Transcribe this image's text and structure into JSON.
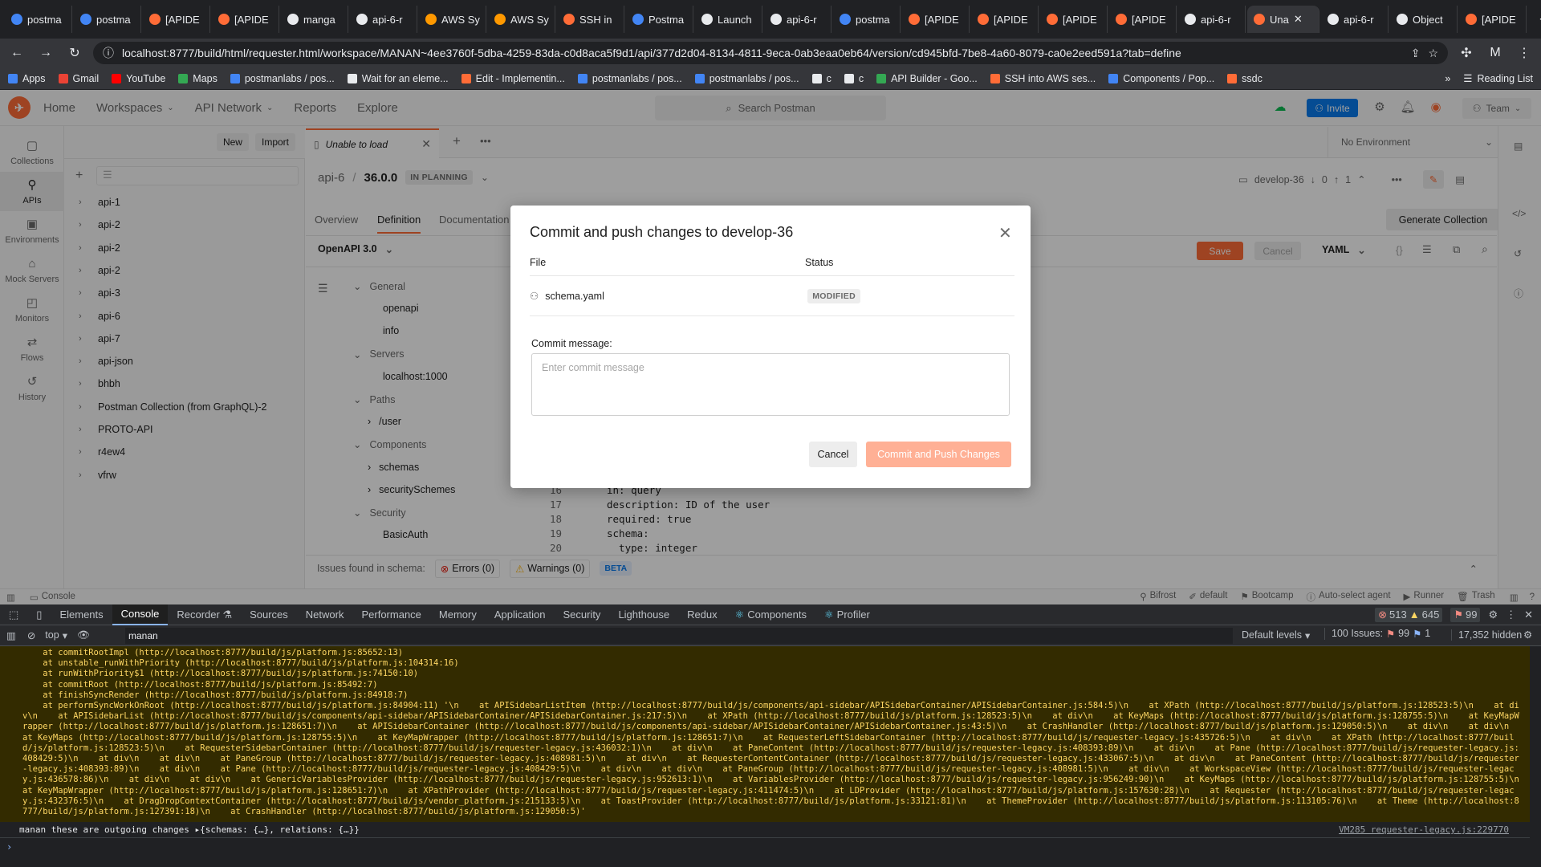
{
  "browser": {
    "tabs": [
      {
        "label": "postma",
        "color": "#4285f4"
      },
      {
        "label": "postma",
        "color": "#4285f4"
      },
      {
        "label": "[APIDE",
        "color": "#ff6c37"
      },
      {
        "label": "[APIDE",
        "color": "#ff6c37"
      },
      {
        "label": "manga",
        "color": "#e8eaed"
      },
      {
        "label": "api-6-r",
        "color": "#e8eaed"
      },
      {
        "label": "AWS Sy",
        "color": "#ff9900"
      },
      {
        "label": "AWS Sy",
        "color": "#ff9900"
      },
      {
        "label": "SSH in",
        "color": "#ff6c37"
      },
      {
        "label": "Postma",
        "color": "#4285f4"
      },
      {
        "label": "Launch",
        "color": "#e8eaed"
      },
      {
        "label": "api-6-r",
        "color": "#e8eaed"
      },
      {
        "label": "postma",
        "color": "#4285f4"
      },
      {
        "label": "[APIDE",
        "color": "#ff6c37"
      },
      {
        "label": "[APIDE",
        "color": "#ff6c37"
      },
      {
        "label": "[APIDE",
        "color": "#ff6c37"
      },
      {
        "label": "[APIDE",
        "color": "#ff6c37"
      },
      {
        "label": "api-6-r",
        "color": "#e8eaed"
      },
      {
        "label": "Una",
        "color": "#ff6c37",
        "active": true
      },
      {
        "label": "api-6-r",
        "color": "#e8eaed"
      },
      {
        "label": "Object",
        "color": "#e8eaed"
      },
      {
        "label": "[APIDE",
        "color": "#ff6c37"
      }
    ],
    "url": "localhost:8777/build/html/requester.html/workspace/MANAN~4ee3760f-5dba-4259-83da-c0d8aca5f9d1/api/377d2d04-8134-4811-9eca-0ab3eaa0eb64/version/cd945bfd-7be8-4a60-8079-ca0e2eed591a?tab=define",
    "profile_initial": "M",
    "bookmarks": [
      {
        "label": "Apps",
        "color": "#4285f4"
      },
      {
        "label": "Gmail",
        "color": "#ea4335"
      },
      {
        "label": "YouTube",
        "color": "#ff0000"
      },
      {
        "label": "Maps",
        "color": "#34a853"
      },
      {
        "label": "postmanlabs / pos...",
        "color": "#4285f4"
      },
      {
        "label": "Wait for an eleme...",
        "color": "#e8eaed"
      },
      {
        "label": "Edit - Implementin...",
        "color": "#ff6c37"
      },
      {
        "label": "postmanlabs / pos...",
        "color": "#4285f4"
      },
      {
        "label": "postmanlabs / pos...",
        "color": "#4285f4"
      },
      {
        "label": "c",
        "color": "#e8eaed"
      },
      {
        "label": "c",
        "color": "#e8eaed"
      },
      {
        "label": "API Builder - Goo...",
        "color": "#34a853"
      },
      {
        "label": "SSH into AWS ses...",
        "color": "#ff6c37"
      },
      {
        "label": "Components / Pop...",
        "color": "#4285f4"
      },
      {
        "label": "ssdc",
        "color": "#ff6c37"
      }
    ],
    "reading_list": "Reading List"
  },
  "header": {
    "nav": [
      "Home",
      "Workspaces",
      "API Network",
      "Reports",
      "Explore"
    ],
    "search_placeholder": "Search Postman",
    "invite": "Invite",
    "team": "Team"
  },
  "rail": [
    {
      "label": "Collections",
      "icon": "collections-icon",
      "glyph": "▢"
    },
    {
      "label": "APIs",
      "icon": "apis-icon",
      "glyph": "⚲",
      "active": true
    },
    {
      "label": "Environments",
      "icon": "environments-icon",
      "glyph": "▣"
    },
    {
      "label": "Mock Servers",
      "icon": "mock-servers-icon",
      "glyph": "⌂"
    },
    {
      "label": "Monitors",
      "icon": "monitors-icon",
      "glyph": "◰"
    },
    {
      "label": "Flows",
      "icon": "flows-icon",
      "glyph": "⇄"
    },
    {
      "label": "History",
      "icon": "history-icon",
      "glyph": "↺"
    }
  ],
  "sidebar": {
    "workspace": "MANAN",
    "new": "New",
    "import": "Import",
    "items": [
      "api-1",
      "api-2",
      "api-2",
      "api-2",
      "api-3",
      "api-6",
      "api-7",
      "api-json",
      "bhbh",
      "Postman Collection (from GraphQL)-2",
      "PROTO-API",
      "r4ew4",
      "vfrw"
    ]
  },
  "main": {
    "tab_label": "Unable to load",
    "environment": "No Environment",
    "api_name": "api-6",
    "version": "36.0.0",
    "stage": "IN PLANNING",
    "branch": "develop-36",
    "behind": "0",
    "ahead": "1",
    "subtabs": [
      "Overview",
      "Definition",
      "Documentation"
    ],
    "generate_collection": "Generate Collection",
    "openapi": "OpenAPI 3.0",
    "save": "Save",
    "cancel": "Cancel",
    "format": "YAML",
    "outline": [
      {
        "label": "General",
        "section": true
      },
      {
        "label": "openapi"
      },
      {
        "label": "info"
      },
      {
        "label": "Servers",
        "section": true
      },
      {
        "label": "localhost:1000"
      },
      {
        "label": "Paths",
        "section": true
      },
      {
        "label": "/user",
        "chev": true
      },
      {
        "label": "Components",
        "section": true
      },
      {
        "label": "schemas",
        "chev": true
      },
      {
        "label": "securitySchemes",
        "chev": true
      },
      {
        "label": "Security",
        "section": true
      },
      {
        "label": "BasicAuth"
      }
    ],
    "code": [
      {
        "n": "16",
        "t": "in: query"
      },
      {
        "n": "17",
        "t": "description: ID of the user"
      },
      {
        "n": "18",
        "t": "required: true"
      },
      {
        "n": "19",
        "t": "schema:"
      },
      {
        "n": "20",
        "t": "  type: integer"
      }
    ],
    "issues_label": "Issues found in schema:",
    "errors": "Errors (0)",
    "warnings": "Warnings (0)",
    "beta": "BETA"
  },
  "statusbar": {
    "console": "Console",
    "items": [
      "Bifrost",
      "default",
      "Bootcamp",
      "Auto-select agent",
      "Runner",
      "Trash"
    ]
  },
  "modal": {
    "title": "Commit and push changes to develop-36",
    "col_file": "File",
    "col_status": "Status",
    "file": "schema.yaml",
    "status": "MODIFIED",
    "commit_label": "Commit message:",
    "commit_placeholder": "Enter commit message",
    "cancel": "Cancel",
    "commit": "Commit and Push Changes"
  },
  "devtools": {
    "tabs": [
      "Elements",
      "Console",
      "Recorder ⚗",
      "Sources",
      "Network",
      "Performance",
      "Memory",
      "Application",
      "Security",
      "Lighthouse",
      "Redux",
      "Components",
      "Profiler"
    ],
    "errors": "513",
    "warnings": "645",
    "issues_count": "99",
    "context": "top",
    "filter": "manan",
    "levels": "Default levels",
    "issues_label": "100 Issues:",
    "issues_err": "99",
    "issues_info": "1",
    "hidden": "17,352 hidden",
    "log_stack": [
      "    at commitRootImpl (http://localhost:8777/build/js/platform.js:85652:13)",
      "    at unstable_runWithPriority (http://localhost:8777/build/js/platform.js:104314:16)",
      "    at runWithPriority$1 (http://localhost:8777/build/js/platform.js:74150:10)",
      "    at commitRoot (http://localhost:8777/build/js/platform.js:85492:7)",
      "    at finishSyncRender (http://localhost:8777/build/js/platform.js:84918:7)",
      "    at performSyncWorkOnRoot (http://localhost:8777/build/js/platform.js:84904:11) '\\n    at APISidebarListItem (http://localhost:8777/build/js/components/api-sidebar/APISidebarContainer/APISidebarContainer.js:584:5)\\n    at XPath (http://localhost:8777/build/js/platform.js:128523:5)\\n    at div\\n    at APISidebarList (http://localhost:8777/build/js/components/api-sidebar/APISidebarContainer/APISidebarContainer.js:217:5)\\n    at XPath (http://localhost:8777/build/js/platform.js:128523:5)\\n    at div\\n    at KeyMaps (http://localhost:8777/build/js/platform.js:128755:5)\\n    at KeyMapWrapper (http://localhost:8777/build/js/platform.js:128651:7)\\n    at APISidebarContainer (http://localhost:8777/build/js/components/api-sidebar/APISidebarContainer/APISidebarContainer.js:43:5)\\n    at CrashHandler (http://localhost:8777/build/js/platform.js:129050:5)\\n    at div\\n    at div\\n    at KeyMaps (http://localhost:8777/build/js/platform.js:128755:5)\\n    at KeyMapWrapper (http://localhost:8777/build/js/platform.js:128651:7)\\n    at RequesterLeftSidebarContainer (http://localhost:8777/build/js/requester-legacy.js:435726:5)\\n    at div\\n    at XPath (http://localhost:8777/build/js/platform.js:128523:5)\\n    at RequesterSidebarContainer (http://localhost:8777/build/js/requester-legacy.js:436032:1)\\n    at div\\n    at PaneContent (http://localhost:8777/build/js/requester-legacy.js:408393:89)\\n    at div\\n    at Pane (http://localhost:8777/build/js/requester-legacy.js:408429:5)\\n    at div\\n    at div\\n    at PaneGroup (http://localhost:8777/build/js/requester-legacy.js:408981:5)\\n    at div\\n    at RequesterContentContainer (http://localhost:8777/build/js/requester-legacy.js:433067:5)\\n    at div\\n    at PaneContent (http://localhost:8777/build/js/requester-legacy.js:408393:89)\\n    at div\\n    at Pane (http://localhost:8777/build/js/requester-legacy.js:408429:5)\\n    at div\\n    at div\\n    at PaneGroup (http://localhost:8777/build/js/requester-legacy.js:408981:5)\\n    at div\\n    at WorkspaceView (http://localhost:8777/build/js/requester-legacy.js:436578:86)\\n    at div\\n    at div\\n    at GenericVariablesProvider (http://localhost:8777/build/js/requester-legacy.js:952613:1)\\n    at VariablesProvider (http://localhost:8777/build/js/requester-legacy.js:956249:90)\\n    at KeyMaps (http://localhost:8777/build/js/platform.js:128755:5)\\n    at KeyMapWrapper (http://localhost:8777/build/js/platform.js:128651:7)\\n    at XPathProvider (http://localhost:8777/build/js/requester-legacy.js:411474:5)\\n    at LDProvider (http://localhost:8777/build/js/platform.js:157630:28)\\n    at Requester (http://localhost:8777/build/js/requester-legacy.js:432376:5)\\n    at DragDropContextContainer (http://localhost:8777/build/js/vendor_platform.js:215133:5)\\n    at ToastProvider (http://localhost:8777/build/js/platform.js:33121:81)\\n    at ThemeProvider (http://localhost:8777/build/js/platform.js:113105:76)\\n    at Theme (http://localhost:8777/build/js/platform.js:127391:18)\\n    at CrashHandler (http://localhost:8777/build/js/platform.js:129050:5)'"
    ],
    "log_line": "manan these are outgoing changes ▸{schemas: {…}, relations: {…}}",
    "log_source": "VM285 requester-legacy.js:229770",
    "prompt": "›"
  }
}
